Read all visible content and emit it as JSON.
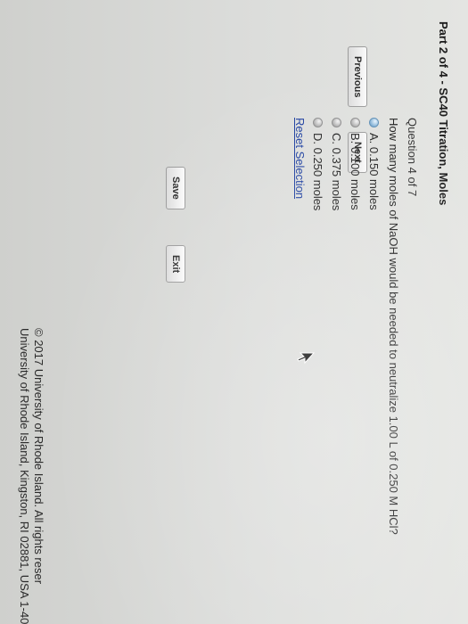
{
  "page": {
    "part_title": "Part 2 of 4 - SC40 Titration, Moles"
  },
  "question": {
    "number_label": "Question 4 of 7",
    "text": "How many moles of NaOH would be needed to neutralize 1.00 L of 0.250 M HCl?",
    "options": [
      {
        "label": "A. 0.150 moles",
        "selected": true
      },
      {
        "label": "B. 0.100 moles",
        "selected": false
      },
      {
        "label": "C. 0.375 moles",
        "selected": false
      },
      {
        "label": "D. 0.250 moles",
        "selected": false
      }
    ],
    "reset_label": "Reset Selection"
  },
  "nav": {
    "previous_label": "Previous",
    "next_label": "Next",
    "save_label": "Save",
    "exit_label": "Exit"
  },
  "footer": {
    "line1": "© 2017 University of Rhode Island. All rights reser",
    "line2": "University of Rhode Island, Kingston, RI 02881, USA 1-40"
  },
  "colors": {
    "link": "#1d3fa0",
    "selected_radio": "#7faed3"
  }
}
